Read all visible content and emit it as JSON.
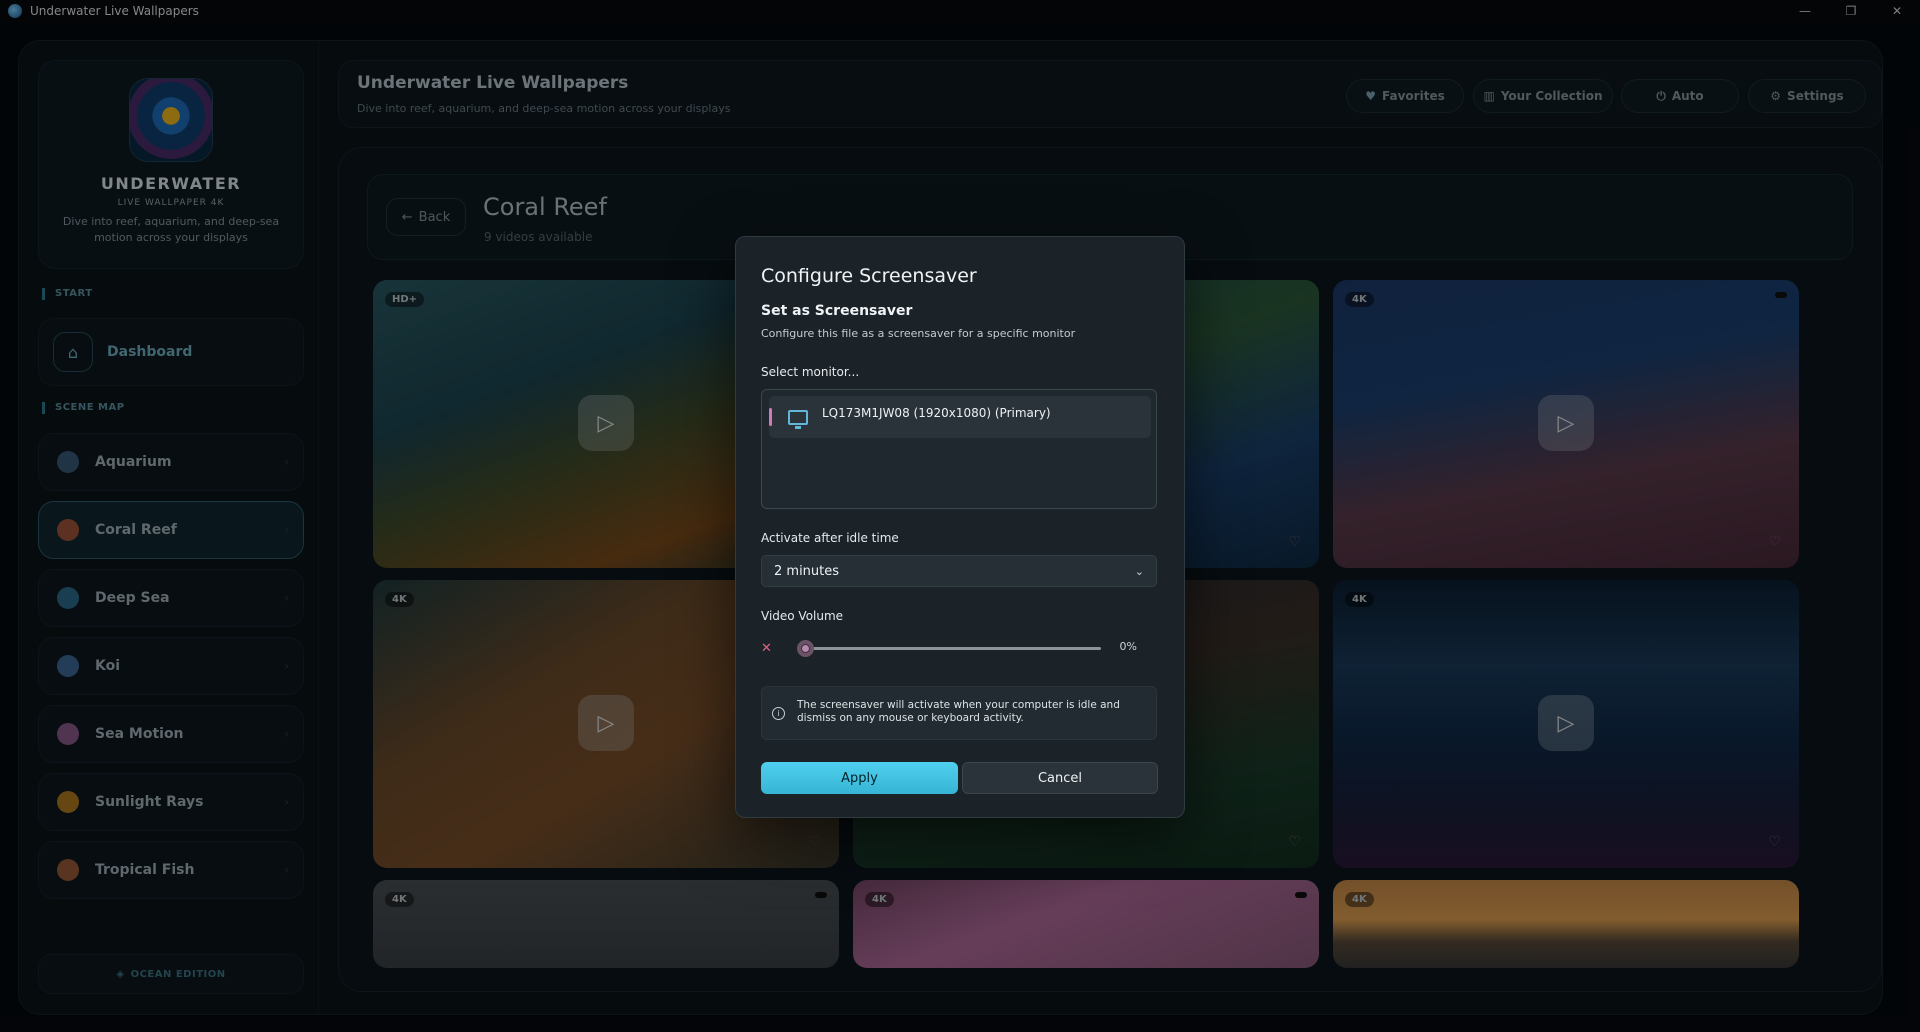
{
  "window": {
    "title": "Underwater Live Wallpapers",
    "controls": {
      "minimize": "—",
      "maximize": "❐",
      "close": "✕"
    }
  },
  "brand": {
    "name": "UNDERWATER",
    "subtitle": "LIVE WALLPAPER 4K",
    "description": "Dive into reef, aquarium, and deep-sea motion across your displays"
  },
  "sidebar": {
    "start_label": "START",
    "dashboard_label": "Dashboard",
    "scene_map_label": "SCENE MAP",
    "items": [
      {
        "label": "Aquarium",
        "color": "#3a5b78"
      },
      {
        "label": "Coral Reef",
        "color": "#a0553a"
      },
      {
        "label": "Deep Sea",
        "color": "#2b6a8c"
      },
      {
        "label": "Koi",
        "color": "#3d6a9a"
      },
      {
        "label": "Sea Motion",
        "color": "#8a5a8a"
      },
      {
        "label": "Sunlight Rays",
        "color": "#b07a1e"
      },
      {
        "label": "Tropical Fish",
        "color": "#9a5a3a"
      }
    ],
    "edition_label": "OCEAN EDITION"
  },
  "header": {
    "title": "Underwater Live Wallpapers",
    "subtitle": "Dive into reef, aquarium, and deep-sea motion across your displays",
    "buttons": {
      "favorites": "Favorites",
      "collection": "Your Collection",
      "auto": "Auto",
      "settings": "Settings"
    }
  },
  "category": {
    "back_label": "Back",
    "title": "Coral Reef",
    "count": "9 videos available"
  },
  "cards": [
    {
      "badge": "HD+"
    },
    {
      "badge": ""
    },
    {
      "badge": "4K"
    },
    {
      "badge": "4K"
    },
    {
      "badge": ""
    },
    {
      "badge": "4K"
    },
    {
      "badge": "4K"
    },
    {
      "badge": "4K"
    },
    {
      "badge": "4K"
    }
  ],
  "dialog": {
    "title": "Configure Screensaver",
    "heading": "Set as Screensaver",
    "description": "Configure this file as a screensaver for a specific monitor",
    "monitor_label": "Select monitor...",
    "monitor_item": "LQ173M1JW08 (1920x1080) (Primary)",
    "idle_label": "Activate after idle time",
    "idle_value": "2 minutes",
    "volume_label": "Video Volume",
    "volume_value": "0%",
    "volume_level": 0,
    "info_text": "The screensaver will activate when your computer is idle and dismiss on any mouse or keyboard activity.",
    "apply_label": "Apply",
    "cancel_label": "Cancel"
  },
  "colors": {
    "accent": "#4fd0ee",
    "selection": "#d27ab8"
  }
}
